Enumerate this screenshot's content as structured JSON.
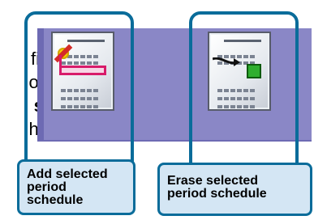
{
  "background_text": {
    "lines": [
      {
        "text": "fic",
        "bold": false
      },
      {
        "text": "ou",
        "bold": false
      },
      {
        "text": "s.",
        "bold": true
      },
      {
        "text": "he",
        "bold": false
      }
    ]
  },
  "buttons": [
    {
      "name": "add-selected-period-schedule",
      "label_lines": [
        "Add selected",
        "period",
        "schedule"
      ]
    },
    {
      "name": "erase-selected-period-schedule",
      "label_lines": [
        "Erase selected",
        "period schedule"
      ]
    }
  ],
  "colors": {
    "band": "#6d6ab3",
    "band_light": "#8a87c6",
    "frame": "#0a6c9a",
    "label_bg": "#d4e6f4",
    "pink": "#d81b6a",
    "green": "#2fae2f",
    "yellow": "#f2d500"
  },
  "icons": {
    "add": "calendar-add-icon",
    "erase": "calendar-erase-icon"
  }
}
